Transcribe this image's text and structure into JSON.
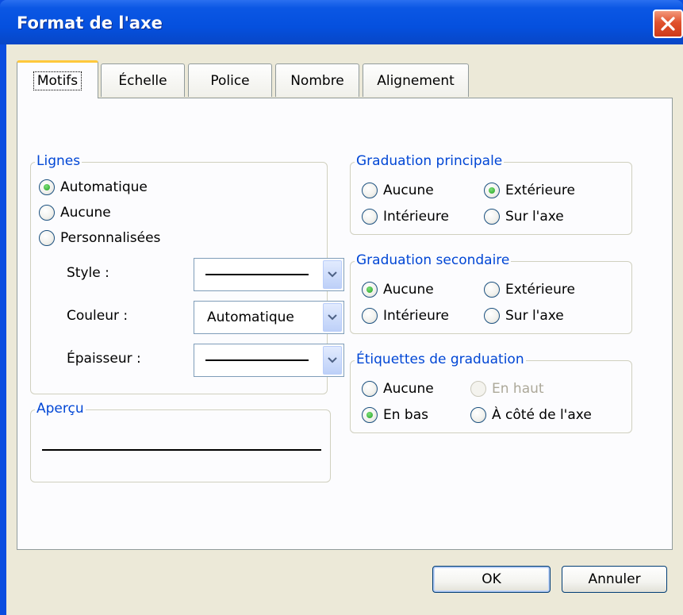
{
  "window": {
    "title": "Format de l'axe"
  },
  "tabs": [
    {
      "label": "Motifs",
      "active": true
    },
    {
      "label": "Échelle",
      "active": false
    },
    {
      "label": "Police",
      "active": false
    },
    {
      "label": "Nombre",
      "active": false
    },
    {
      "label": "Alignement",
      "active": false
    }
  ],
  "lignes": {
    "legend": "Lignes",
    "options": [
      {
        "label": "Automatique",
        "checked": true
      },
      {
        "label": "Aucune",
        "checked": false
      },
      {
        "label": "Personnalisées",
        "checked": false
      }
    ],
    "style_label": "Style :",
    "couleur_label": "Couleur :",
    "couleur_value": "Automatique",
    "epaisseur_label": "Épaisseur :"
  },
  "apercu": {
    "legend": "Aperçu"
  },
  "graduation_principale": {
    "legend": "Graduation principale",
    "options": [
      {
        "label": "Aucune",
        "checked": false
      },
      {
        "label": "Extérieure",
        "checked": true
      },
      {
        "label": "Intérieure",
        "checked": false
      },
      {
        "label": "Sur l'axe",
        "checked": false
      }
    ]
  },
  "graduation_secondaire": {
    "legend": "Graduation secondaire",
    "options": [
      {
        "label": "Aucune",
        "checked": true
      },
      {
        "label": "Extérieure",
        "checked": false
      },
      {
        "label": "Intérieure",
        "checked": false
      },
      {
        "label": "Sur l'axe",
        "checked": false
      }
    ]
  },
  "etiquettes": {
    "legend": "Étiquettes de graduation",
    "options": [
      {
        "label": "Aucune",
        "checked": false,
        "enabled": true
      },
      {
        "label": "En haut",
        "checked": false,
        "enabled": false
      },
      {
        "label": "En bas",
        "checked": true,
        "enabled": true
      },
      {
        "label": "À côté de l'axe",
        "checked": false,
        "enabled": true
      }
    ]
  },
  "buttons": {
    "ok": "OK",
    "cancel": "Annuler"
  },
  "colors": {
    "title_bar": "#0550de",
    "dialog_bg": "#ece9d8",
    "panel_bg": "#fcfcfe",
    "legend_text": "#0046d5",
    "close_button": "#e0522e",
    "radio_dot": "#21a121"
  }
}
